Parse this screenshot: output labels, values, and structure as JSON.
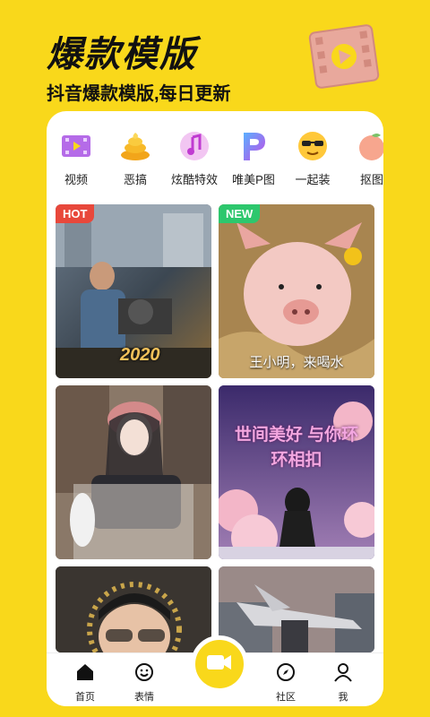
{
  "hero": {
    "title": "爆款模版",
    "subtitle": "抖音爆款模版,每日更新"
  },
  "categories": [
    {
      "label": "视频",
      "icon": "film-icon"
    },
    {
      "label": "恶搞",
      "icon": "poop-icon"
    },
    {
      "label": "炫酷特效",
      "icon": "music-note-icon"
    },
    {
      "label": "唯美P图",
      "icon": "p-letter-icon"
    },
    {
      "label": "一起装",
      "icon": "sunglasses-emoji-icon"
    },
    {
      "label": "抠图",
      "icon": "peach-icon"
    }
  ],
  "templates": [
    {
      "tag": "HOT",
      "caption": "",
      "art_text": "2020"
    },
    {
      "tag": "NEW",
      "caption": "王小明，来喝水"
    },
    {
      "tag": "",
      "caption": ""
    },
    {
      "tag": "",
      "caption": "",
      "art_text": "世间美好 与你环环相扣"
    },
    {
      "tag": "",
      "caption": ""
    },
    {
      "tag": "",
      "caption": ""
    }
  ],
  "tabbar": {
    "home": "首页",
    "emoji": "表情",
    "community": "社区",
    "me": "我"
  },
  "colors": {
    "brand_yellow": "#F9D81B",
    "hot_tag": "#E8483B",
    "new_tag": "#2DC76D"
  }
}
